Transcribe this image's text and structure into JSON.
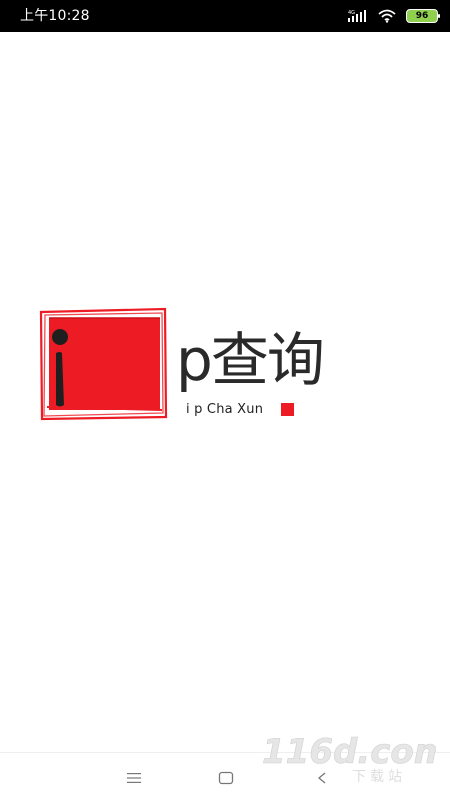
{
  "status_bar": {
    "time": "上午10:28",
    "icons": [
      "signal-icon",
      "wifi-icon",
      "battery-icon"
    ],
    "battery": "96",
    "battery_color": "#8fd14f"
  },
  "splash": {
    "logo_letter": "i",
    "wordmark": "p查询",
    "subtitle": "i p Cha Xun",
    "accent_color": "#ed1c24"
  },
  "nav_bar": {
    "buttons": [
      "menu-icon",
      "home-icon",
      "back-icon"
    ]
  },
  "watermark": {
    "logo": "116d.com",
    "caption": "下载站"
  }
}
